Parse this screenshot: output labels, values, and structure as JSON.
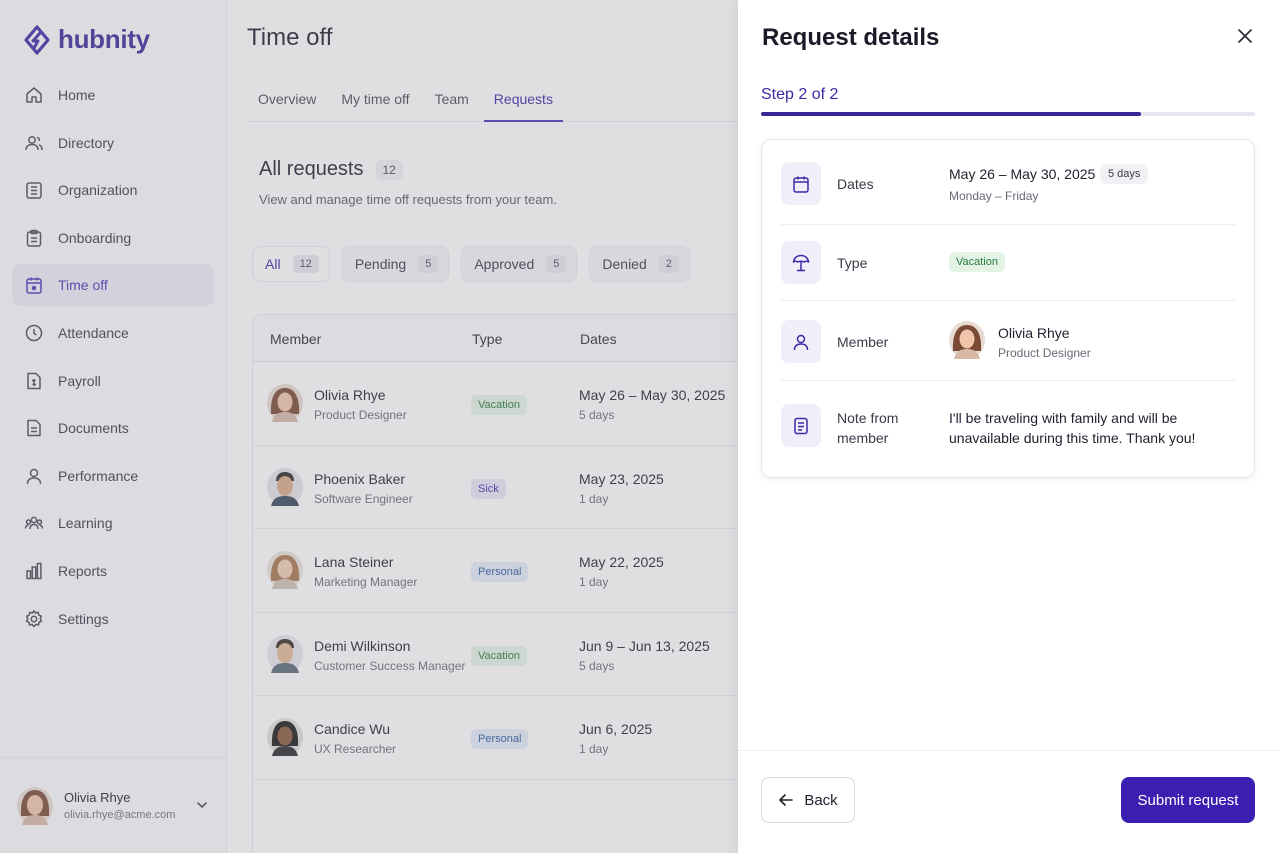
{
  "brand": {
    "name": "hubnity",
    "accent": "#3b2aa6"
  },
  "sidebar": {
    "items": [
      {
        "label": "Home",
        "icon": "home-icon"
      },
      {
        "label": "Directory",
        "icon": "users-icon"
      },
      {
        "label": "Organization",
        "icon": "org-icon"
      },
      {
        "label": "Onboarding",
        "icon": "clipboard-icon"
      },
      {
        "label": "Time off",
        "icon": "calendar-icon",
        "active": true
      },
      {
        "label": "Attendance",
        "icon": "clock-icon"
      },
      {
        "label": "Payroll",
        "icon": "payroll-icon"
      },
      {
        "label": "Documents",
        "icon": "document-icon"
      },
      {
        "label": "Performance",
        "icon": "person-icon"
      },
      {
        "label": "Learning",
        "icon": "group-icon"
      },
      {
        "label": "Reports",
        "icon": "bar-chart-icon"
      },
      {
        "label": "Settings",
        "icon": "gear-icon"
      }
    ],
    "user": {
      "name": "Olivia Rhye",
      "email": "olivia.rhye@acme.com"
    }
  },
  "main": {
    "title": "Time off",
    "tabs": [
      "Overview",
      "My time off",
      "Team",
      "Requests"
    ],
    "active_tab": "Requests",
    "section_title": "All requests",
    "section_count": "12",
    "section_sub": "View and manage time off requests from your team.",
    "filters": [
      {
        "label": "All",
        "count": "12"
      },
      {
        "label": "Pending",
        "count": "5"
      },
      {
        "label": "Approved",
        "count": "5"
      },
      {
        "label": "Denied",
        "count": "2"
      }
    ],
    "columns": [
      "Member",
      "Type",
      "Dates"
    ],
    "rows": [
      {
        "name": "Olivia Rhye",
        "role": "Product Designer",
        "type": "Vacation",
        "dates": "May 26 – May 30, 2025",
        "days": "5 days"
      },
      {
        "name": "Phoenix Baker",
        "role": "Software Engineer",
        "type": "Sick",
        "dates": "May 23, 2025",
        "days": "1 day"
      },
      {
        "name": "Lana Steiner",
        "role": "Marketing Manager",
        "type": "Personal",
        "dates": "May 22, 2025",
        "days": "1 day"
      },
      {
        "name": "Demi Wilkinson",
        "role": "Customer Success Manager",
        "type": "Vacation",
        "dates": "Jun 9 – Jun 13, 2025",
        "days": "5 days"
      },
      {
        "name": "Candice Wu",
        "role": "UX Researcher",
        "type": "Personal",
        "dates": "Jun 6, 2025",
        "days": "1 day"
      }
    ]
  },
  "drawer": {
    "title": "Request details",
    "step": "Step 2 of 2",
    "progress": 0.77,
    "dates_label": "Dates",
    "dates_value": "May 26 – May 30, 2025",
    "dates_days": "5 days",
    "dates_sub": "Monday – Friday",
    "type_label": "Type",
    "type_value": "Vacation",
    "member_label": "Member",
    "member_name": "Olivia Rhye",
    "member_role": "Product Designer",
    "note_label": "Note from member",
    "note_value": "I'll be traveling with family and will be unavailable during this time. Thank you!",
    "back_label": "Back",
    "submit_label": "Submit request"
  }
}
